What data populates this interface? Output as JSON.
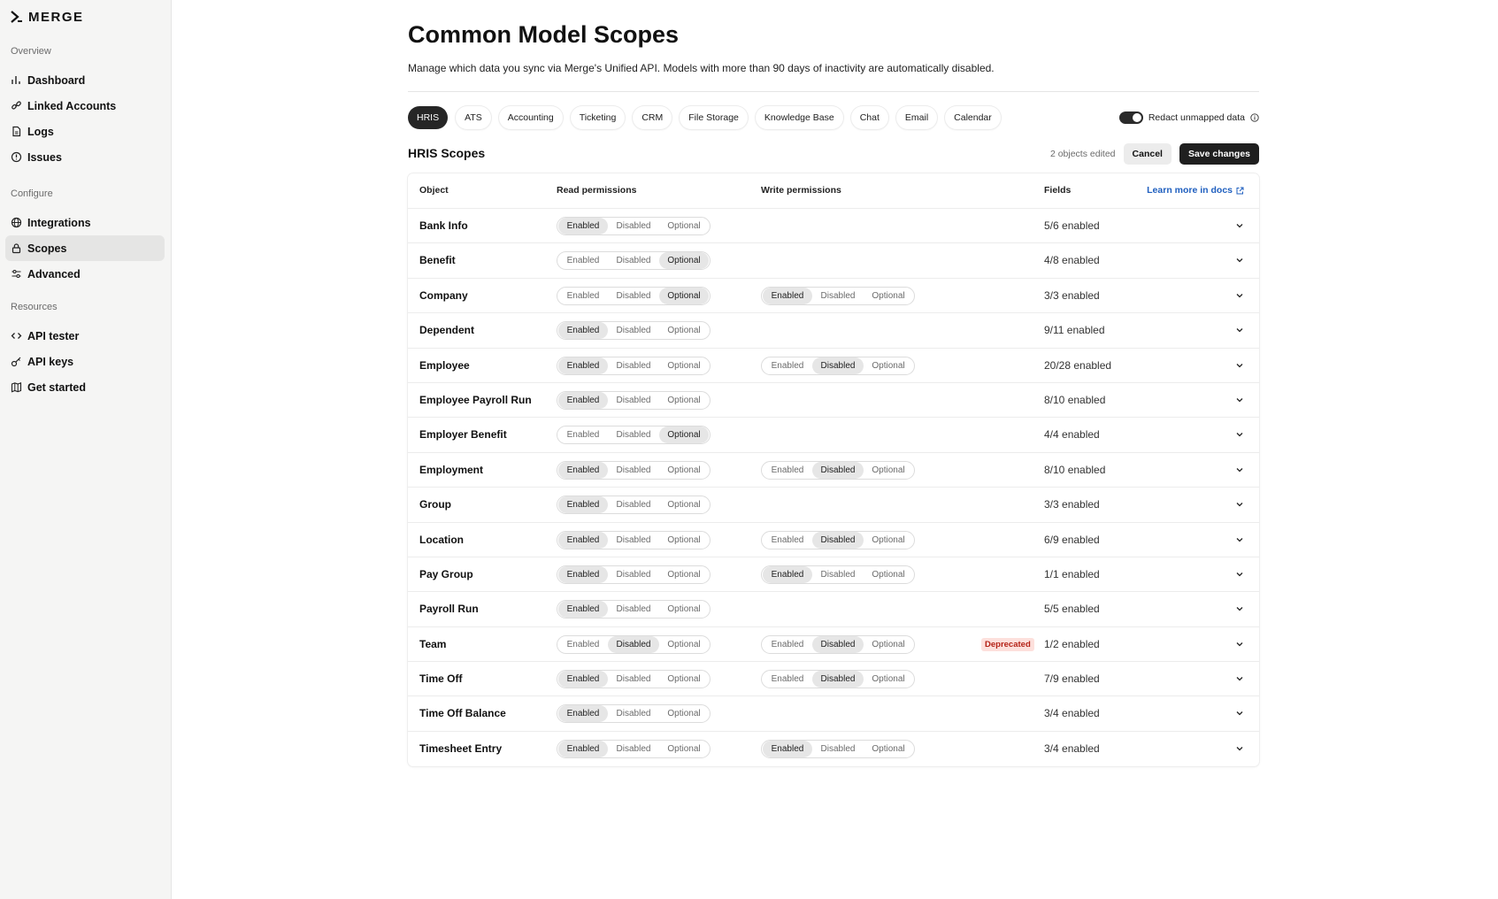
{
  "brand": {
    "logo_text": "MERGE"
  },
  "sidebar": {
    "sections": [
      {
        "label": "Overview",
        "items": [
          {
            "label": "Dashboard",
            "icon": "chart-bar-icon"
          },
          {
            "label": "Linked Accounts",
            "icon": "link-icon"
          },
          {
            "label": "Logs",
            "icon": "file-log-icon"
          },
          {
            "label": "Issues",
            "icon": "alert-circle-icon"
          }
        ]
      },
      {
        "label": "Configure",
        "items": [
          {
            "label": "Integrations",
            "icon": "globe-icon"
          },
          {
            "label": "Scopes",
            "icon": "lock-icon",
            "active": true
          },
          {
            "label": "Advanced",
            "icon": "sliders-icon"
          }
        ]
      },
      {
        "label": "Resources",
        "items": [
          {
            "label": "API tester",
            "icon": "code-icon"
          },
          {
            "label": "API keys",
            "icon": "key-icon"
          },
          {
            "label": "Get started",
            "icon": "map-icon"
          }
        ]
      }
    ]
  },
  "page": {
    "title": "Common Model Scopes",
    "description": "Manage which data you sync via Merge's Unified API. Models with more than 90 days of inactivity are automatically disabled."
  },
  "tabs": [
    "HRIS",
    "ATS",
    "Accounting",
    "Ticketing",
    "CRM",
    "File Storage",
    "Knowledge Base",
    "Chat",
    "Email",
    "Calendar"
  ],
  "active_tab": "HRIS",
  "redact": {
    "label": "Redact unmapped data",
    "enabled": true
  },
  "scopes": {
    "title": "HRIS Scopes",
    "edited_text": "2 objects edited",
    "cancel_label": "Cancel",
    "save_label": "Save changes"
  },
  "table": {
    "headers": {
      "object": "Object",
      "read": "Read permissions",
      "write": "Write permissions",
      "fields": "Fields",
      "docs_link": "Learn more in docs"
    },
    "options": [
      "Enabled",
      "Disabled",
      "Optional"
    ],
    "deprecated_label": "Deprecated",
    "rows": [
      {
        "name": "Bank Info",
        "read": "Enabled",
        "write": null,
        "fields": "5/6 enabled"
      },
      {
        "name": "Benefit",
        "read": "Optional",
        "write": null,
        "fields": "4/8 enabled"
      },
      {
        "name": "Company",
        "read": "Optional",
        "write": "Enabled",
        "fields": "3/3 enabled"
      },
      {
        "name": "Dependent",
        "read": "Enabled",
        "write": null,
        "fields": "9/11 enabled"
      },
      {
        "name": "Employee",
        "read": "Enabled",
        "write": "Disabled",
        "fields": "20/28 enabled"
      },
      {
        "name": "Employee Payroll Run",
        "read": "Enabled",
        "write": null,
        "fields": "8/10 enabled"
      },
      {
        "name": "Employer Benefit",
        "read": "Optional",
        "write": null,
        "fields": "4/4 enabled"
      },
      {
        "name": "Employment",
        "read": "Enabled",
        "write": "Disabled",
        "fields": "8/10 enabled"
      },
      {
        "name": "Group",
        "read": "Enabled",
        "write": null,
        "fields": "3/3 enabled"
      },
      {
        "name": "Location",
        "read": "Enabled",
        "write": "Disabled",
        "fields": "6/9 enabled"
      },
      {
        "name": "Pay Group",
        "read": "Enabled",
        "write": "Enabled",
        "fields": "1/1 enabled"
      },
      {
        "name": "Payroll Run",
        "read": "Enabled",
        "write": null,
        "fields": "5/5 enabled"
      },
      {
        "name": "Team",
        "read": "Disabled",
        "write": "Disabled",
        "fields": "1/2 enabled",
        "deprecated": true
      },
      {
        "name": "Time Off",
        "read": "Enabled",
        "write": "Disabled",
        "fields": "7/9 enabled"
      },
      {
        "name": "Time Off Balance",
        "read": "Enabled",
        "write": null,
        "fields": "3/4 enabled"
      },
      {
        "name": "Timesheet Entry",
        "read": "Enabled",
        "write": "Enabled",
        "fields": "3/4 enabled"
      }
    ]
  }
}
